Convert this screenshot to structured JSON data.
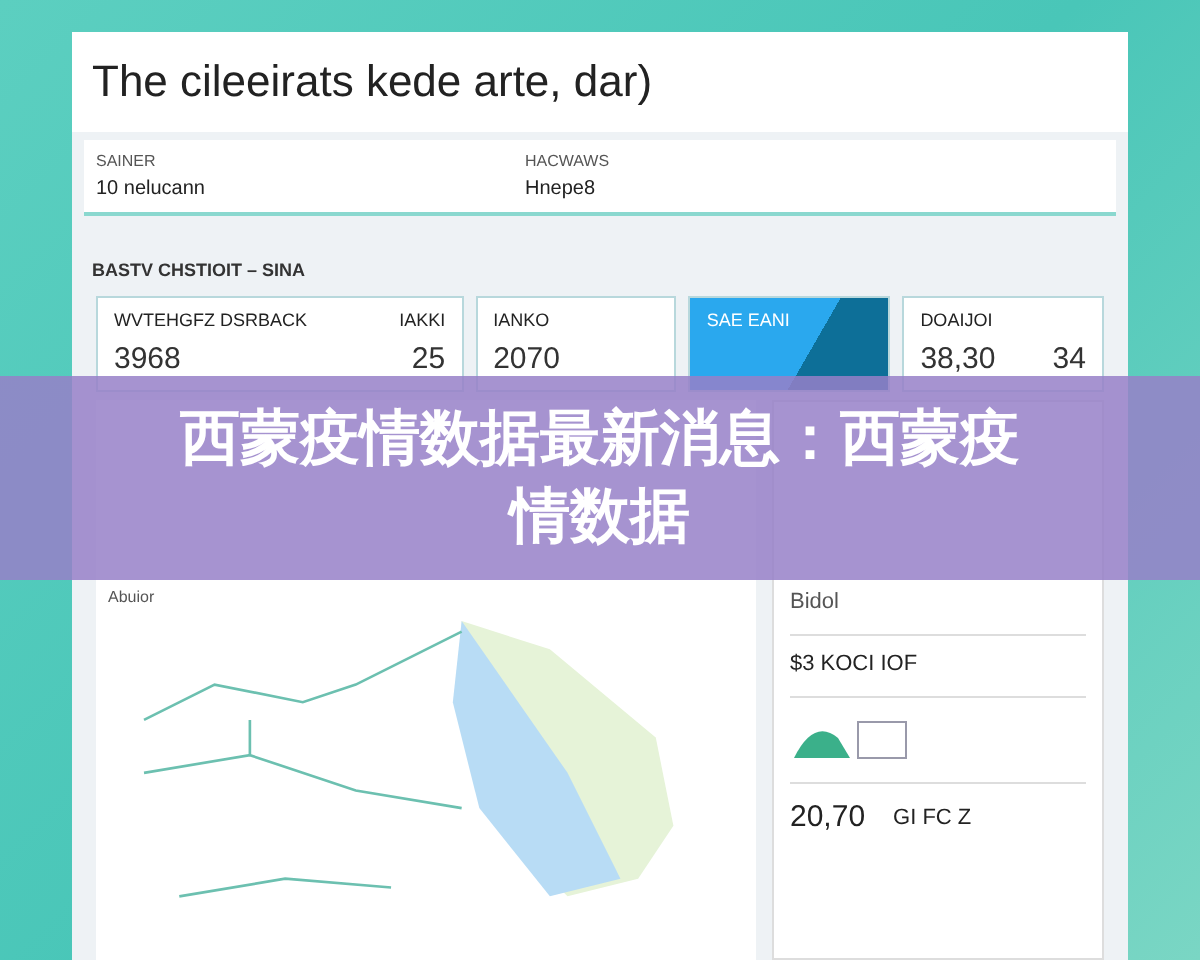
{
  "header": {
    "title": "The cileeirats kede arte, dar)"
  },
  "filters": [
    {
      "label": "SAINER",
      "value": "10 nelucann"
    },
    {
      "label": "HACWAWS",
      "value": "Hnepe8"
    }
  ],
  "section": {
    "title": "BASTV CHSTIOIT – SINA"
  },
  "cards": [
    {
      "kind": "plain",
      "label": "WVTEHGFZ DSRBACK",
      "sublabel": "IAKKI",
      "value": "3968",
      "extra": "25"
    },
    {
      "kind": "plain",
      "label": "IANKO",
      "value": "2070"
    },
    {
      "kind": "highlight",
      "label": "SAE EANI"
    },
    {
      "kind": "plain",
      "label": "DOAIJOI",
      "value": "38,30",
      "extra": "34"
    }
  ],
  "banner": {
    "text": "西蒙疫情数据最新消息：西蒙疫情数据"
  },
  "map": {
    "label": "Abuior"
  },
  "side_panel": {
    "title": "Bidol",
    "rows": [
      {
        "kind": "text",
        "value": "$3 KOCI IOF"
      },
      {
        "kind": "chart"
      },
      {
        "kind": "stat",
        "value": "20,70",
        "extra": "GI FC Z"
      }
    ]
  }
}
